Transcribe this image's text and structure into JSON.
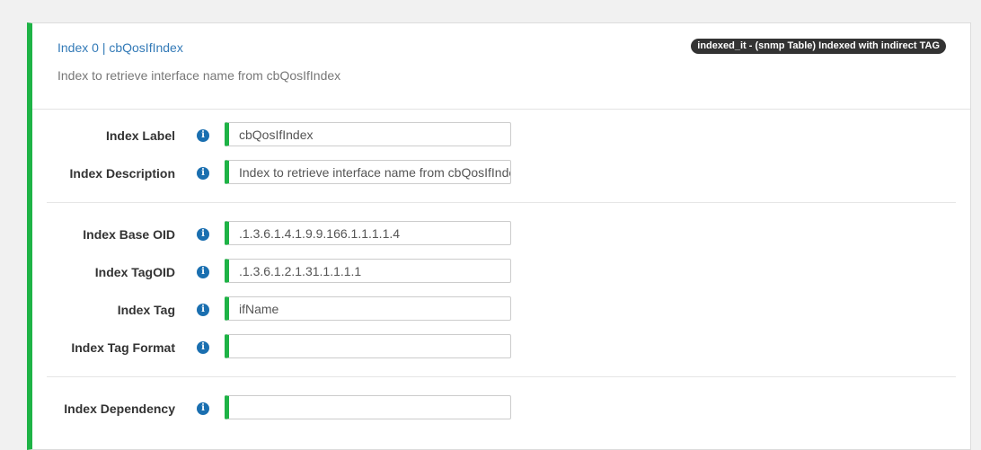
{
  "header": {
    "title": "Index 0 | cbQosIfIndex",
    "description": "Index to retrieve interface name from cbQosIfIndex",
    "badge": "indexed_it - (snmp Table) Indexed with indirect TAG"
  },
  "info_glyph": "i",
  "fields": {
    "index_label": {
      "label": "Index Label",
      "value": "cbQosIfIndex"
    },
    "index_description": {
      "label": "Index Description",
      "value": "Index to retrieve interface name from cbQosIfIndex"
    },
    "index_base_oid": {
      "label": "Index Base OID",
      "value": ".1.3.6.1.4.1.9.9.166.1.1.1.1.4"
    },
    "index_tag_oid": {
      "label": "Index TagOID",
      "value": ".1.3.6.1.2.1.31.1.1.1.1"
    },
    "index_tag": {
      "label": "Index Tag",
      "value": "ifName"
    },
    "index_tag_format": {
      "label": "Index Tag Format",
      "value": ""
    },
    "index_dependency": {
      "label": "Index Dependency",
      "value": ""
    }
  },
  "colors": {
    "accent_green": "#1eb346",
    "link_blue": "#337ab7",
    "info_icon_blue": "#1a6fb0",
    "badge_dark": "#333333"
  }
}
